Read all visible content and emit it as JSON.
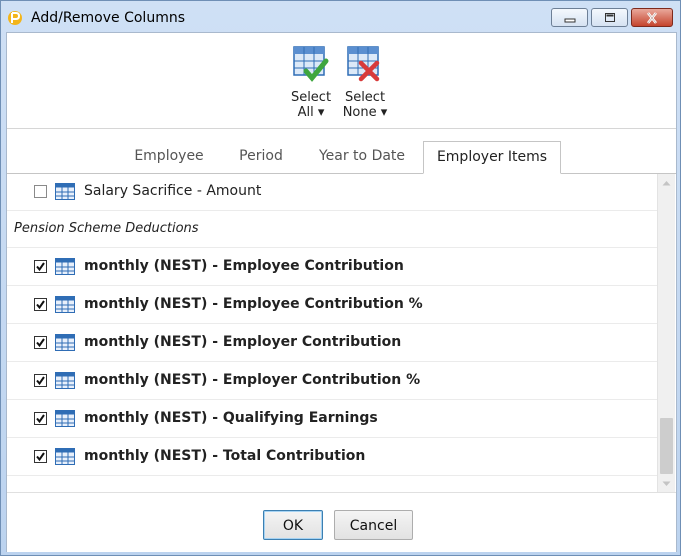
{
  "window": {
    "title": "Add/Remove Columns"
  },
  "toolbar": {
    "select_all": {
      "line1": "Select",
      "line2": "All ▾",
      "icon": "table-check-icon"
    },
    "select_none": {
      "line1": "Select",
      "line2": "None ▾",
      "icon": "table-x-icon"
    }
  },
  "tabs": [
    {
      "label": "Employee",
      "active": false
    },
    {
      "label": "Period",
      "active": false
    },
    {
      "label": "Year to Date",
      "active": false
    },
    {
      "label": "Employer Items",
      "active": true
    }
  ],
  "list": {
    "items": [
      {
        "type": "item",
        "label": "Salary Sacrifice - Amount",
        "checked": false,
        "bold": false
      },
      {
        "type": "group",
        "label": "Pension Scheme Deductions"
      },
      {
        "type": "item",
        "label": "monthly (NEST) - Employee Contribution",
        "checked": true,
        "bold": true
      },
      {
        "type": "item",
        "label": "monthly (NEST) - Employee Contribution %",
        "checked": true,
        "bold": true
      },
      {
        "type": "item",
        "label": "monthly (NEST) - Employer Contribution",
        "checked": true,
        "bold": true
      },
      {
        "type": "item",
        "label": "monthly (NEST) - Employer Contribution %",
        "checked": true,
        "bold": true
      },
      {
        "type": "item",
        "label": "monthly (NEST) - Qualifying Earnings",
        "checked": true,
        "bold": true
      },
      {
        "type": "item",
        "label": "monthly (NEST) - Total Contribution",
        "checked": true,
        "bold": true
      }
    ]
  },
  "footer": {
    "ok_label": "OK",
    "cancel_label": "Cancel"
  },
  "colors": {
    "titlebar": "#c9dcf3",
    "close_button": "#c5442d",
    "grid_icon": "#2f6db5",
    "check_green": "#3fa63f",
    "x_red": "#d83b3b"
  }
}
